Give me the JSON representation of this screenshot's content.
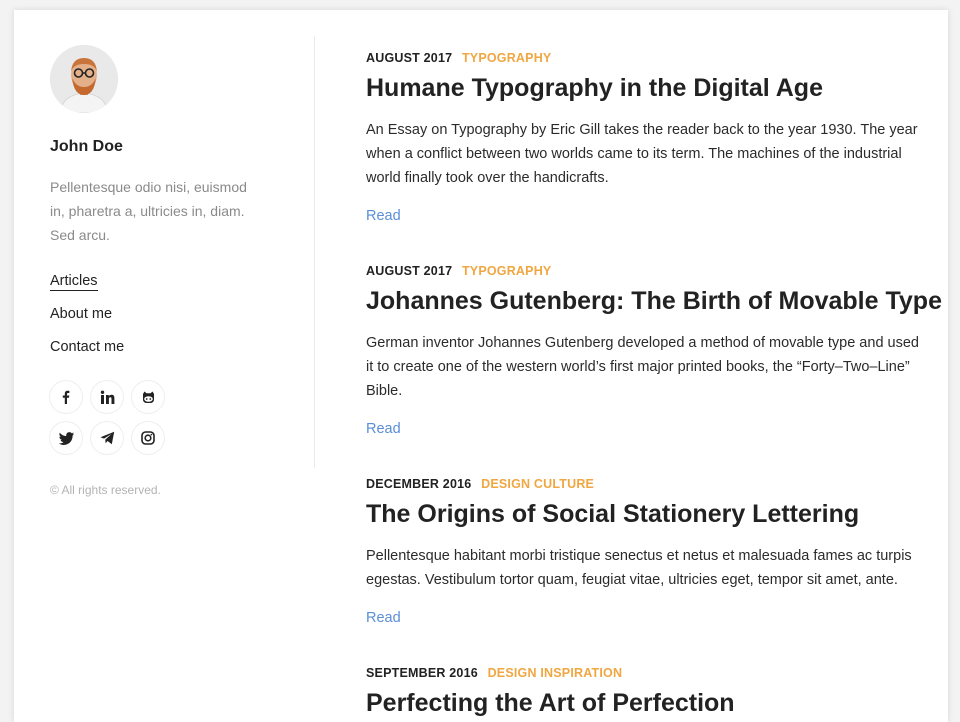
{
  "author": {
    "name": "John Doe",
    "bio": "Pellentesque odio nisi, euismod in, pharetra a, ultricies in, diam. Sed arcu."
  },
  "nav": {
    "items": [
      {
        "label": "Articles",
        "active": true
      },
      {
        "label": "About me",
        "active": false
      },
      {
        "label": "Contact me",
        "active": false
      }
    ]
  },
  "social": [
    {
      "icon": "facebook-icon"
    },
    {
      "icon": "linkedin-icon"
    },
    {
      "icon": "github-icon"
    },
    {
      "icon": "twitter-icon"
    },
    {
      "icon": "telegram-icon"
    },
    {
      "icon": "instagram-icon"
    }
  ],
  "footer": {
    "copyright": "© All rights reserved."
  },
  "colors": {
    "accent": "#f0a742",
    "link": "#5b8ed6",
    "text": "#222222",
    "muted": "#8a8a8a"
  },
  "articles": [
    {
      "date": "AUGUST 2017",
      "category": "TYPOGRAPHY",
      "title": "Humane Typography in the Digital Age",
      "excerpt": "An Essay on Typography by Eric Gill takes the reader back to the year 1930. The year when a conflict between two worlds came to its term. The machines of the industrial world finally took over the handicrafts.",
      "read_label": "Read"
    },
    {
      "date": "AUGUST 2017",
      "category": "TYPOGRAPHY",
      "title": "Johannes Gutenberg: The Birth of Movable Type",
      "excerpt": "German inventor Johannes Gutenberg developed a method of movable type and used it to create one of the western world’s first major printed books, the “Forty–Two–Line” Bible.",
      "read_label": "Read"
    },
    {
      "date": "DECEMBER 2016",
      "category": "DESIGN CULTURE",
      "title": "The Origins of Social Stationery Lettering",
      "excerpt": "Pellentesque habitant morbi tristique senectus et netus et malesuada fames ac turpis egestas. Vestibulum tortor quam, feugiat vitae, ultricies eget, tempor sit amet, ante.",
      "read_label": "Read"
    },
    {
      "date": "SEPTEMBER 2016",
      "category": "DESIGN INSPIRATION",
      "title": "Perfecting the Art of Perfection",
      "excerpt": "",
      "read_label": ""
    }
  ]
}
